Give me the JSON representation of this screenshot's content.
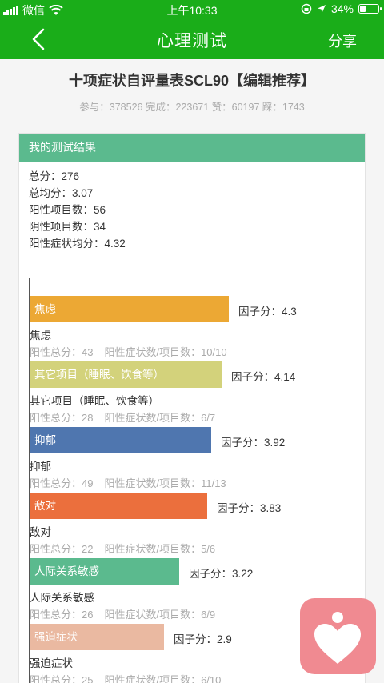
{
  "status_bar": {
    "carrier": "微信",
    "time": "上午10:33",
    "battery_text": "34%",
    "battery_level": 0.34
  },
  "nav": {
    "title": "心理测试",
    "share_label": "分享"
  },
  "test": {
    "title": "十项症状自评量表SCL90【编辑推荐】",
    "stats": "参与：378526 完成：223671 赞：60197 踩：1743"
  },
  "result": {
    "header": "我的测试结果",
    "summary": [
      "总分：276",
      "总均分：3.07",
      "阳性项目数：56",
      "阴性项目数：34",
      "阳性症状均分：4.32"
    ]
  },
  "factors": [
    {
      "name": "焦虑",
      "score_text": "因子分：4.3",
      "score": 4.3,
      "color": "#eca834",
      "detail_total": "阳性总分：43",
      "detail_ratio": "阳性症状数/项目数：10/10"
    },
    {
      "name": "其它项目（睡眠、饮食等）",
      "score_text": "因子分：4.14",
      "score": 4.14,
      "color": "#d3d27b",
      "detail_total": "阳性总分：28",
      "detail_ratio": "阳性症状数/项目数：6/7"
    },
    {
      "name": "抑郁",
      "score_text": "因子分：3.92",
      "score": 3.92,
      "color": "#4f76af",
      "detail_total": "阳性总分：49",
      "detail_ratio": "阳性症状数/项目数：11/13"
    },
    {
      "name": "敌对",
      "score_text": "因子分：3.83",
      "score": 3.83,
      "color": "#eb6f3d",
      "detail_total": "阳性总分：22",
      "detail_ratio": "阳性症状数/项目数：5/6"
    },
    {
      "name": "人际关系敏感",
      "score_text": "因子分：3.22",
      "score": 3.22,
      "color": "#5bba8e",
      "detail_total": "阳性总分：26",
      "detail_ratio": "阳性症状数/项目数：6/9"
    },
    {
      "name": "强迫症状",
      "score_text": "因子分：2.9",
      "score": 2.9,
      "color": "#eab9a1",
      "detail_total": "阳性总分：25",
      "detail_ratio": "阳性症状数/项目数：6/10"
    }
  ],
  "icons": {
    "back": "chevron-left-icon",
    "fab": "heart-person-icon"
  }
}
